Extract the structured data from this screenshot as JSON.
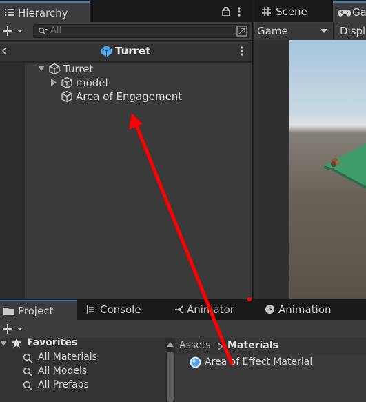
{
  "hierarchy": {
    "tab_label": "Hierarchy",
    "search_placeholder": "All",
    "scene_title": "Turret",
    "tree": [
      {
        "label": "Turret",
        "expanded": true
      },
      {
        "label": "model",
        "expanded": false
      },
      {
        "label": "Area of Engagement"
      }
    ]
  },
  "scene_tab": {
    "label": "Scene"
  },
  "game_tab": {
    "label": "Ga"
  },
  "game_toolbar": {
    "view_label": "Game",
    "display_label": "Displa"
  },
  "bottom_tabs": {
    "project": "Project",
    "console": "Console",
    "animator": "Animator",
    "animation": "Animation"
  },
  "project": {
    "favorites_label": "Favorites",
    "favorites": [
      "All Materials",
      "All Models",
      "All Prefabs"
    ],
    "breadcrumb": {
      "root": "Assets",
      "current": "Materials"
    },
    "assets": [
      "Area of Effect Material"
    ]
  },
  "colors": {
    "annotation_arrow": "#ff0000",
    "game_sky": "#b8d0e0",
    "game_ground": "#6a6258",
    "platform": "#3f9a6c",
    "prefab_icon": "#4fa3e6"
  }
}
